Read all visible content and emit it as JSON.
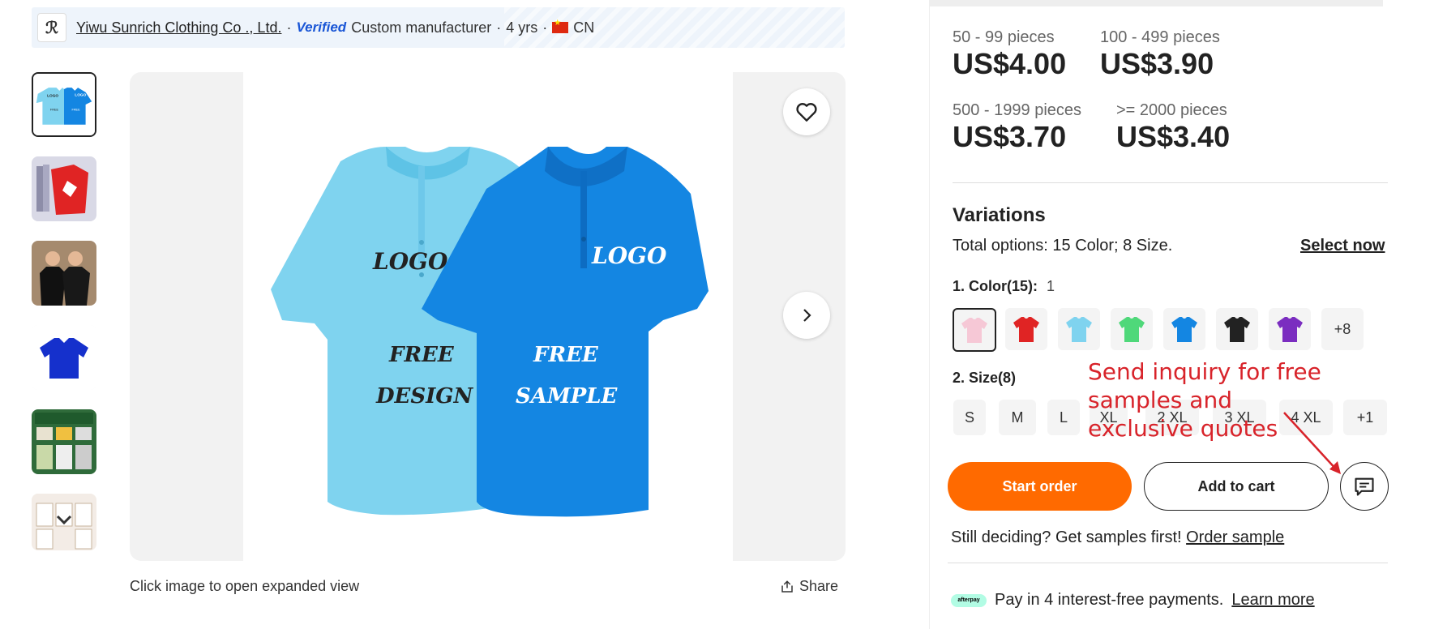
{
  "supplier": {
    "name": "Yiwu Sunrich Clothing Co ., Ltd.",
    "separator1": "·",
    "verified": "Verified",
    "type": "Custom manufacturer",
    "separator2": "·",
    "years": "4 yrs",
    "separator3": "·",
    "country": "CN"
  },
  "thumbnails": [
    {
      "name": "thumb-two-polos"
    },
    {
      "name": "thumb-red-shirts"
    },
    {
      "name": "thumb-models"
    },
    {
      "name": "thumb-blue-polo"
    },
    {
      "name": "thumb-manufacturer"
    },
    {
      "name": "thumb-certificates"
    }
  ],
  "main_image": {
    "logo_text": "LOGO",
    "left_text_line1": "FREE",
    "left_text_line2": "DESIGN",
    "right_text_line1": "FREE",
    "right_text_line2": "SAMPLE"
  },
  "caption": "Click image to open expanded view",
  "share_label": "Share",
  "pricing": [
    {
      "range": "50 - 99 pieces",
      "price": "US$4.00"
    },
    {
      "range": "100 - 499 pieces",
      "price": "US$3.90"
    },
    {
      "range": "500 - 1999 pieces",
      "price": "US$3.70"
    },
    {
      "range": ">= 2000 pieces",
      "price": "US$3.40"
    }
  ],
  "variations": {
    "title": "Variations",
    "total_label": "Total options:",
    "total_value": "15 Color; 8 Size.",
    "select_now": "Select now",
    "color_label": "1. Color(15):",
    "color_selected_count": "1",
    "colors": [
      "#f6c8d6",
      "#e02424",
      "#7fd3ef",
      "#4fd87a",
      "#1486e2",
      "#222222",
      "#7b2dc0"
    ],
    "color_more": "+8",
    "size_label": "2. Size(8)",
    "sizes": [
      "S",
      "M",
      "L",
      "XL",
      "2 XL",
      "3 XL",
      "4 XL"
    ],
    "size_more": "+1"
  },
  "annotation": "Send inquiry for free samples and exclusive quotes",
  "buttons": {
    "start_order": "Start order",
    "add_to_cart": "Add to cart"
  },
  "still_deciding": {
    "text": "Still deciding? Get samples first!",
    "link": "Order sample"
  },
  "payment": {
    "badge": "afterpay",
    "text": "Pay in 4 interest-free payments.",
    "link": "Learn more"
  },
  "colors": {
    "accent": "#ff6a00",
    "annotation": "#d8232a",
    "verified": "#1a56d6"
  }
}
